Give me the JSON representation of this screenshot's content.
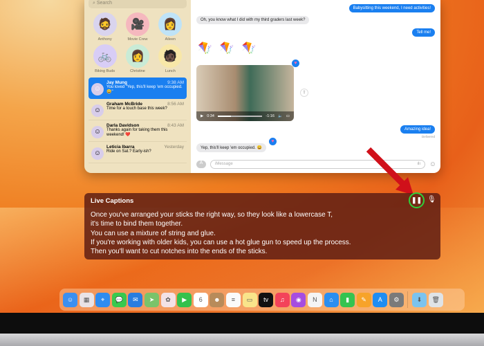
{
  "messages": {
    "search_placeholder": "Search",
    "pinned": [
      {
        "name": "Anthony",
        "emoji": "🧔",
        "color": "#d9d4ee"
      },
      {
        "name": "Movie Crew",
        "emoji": "🎥",
        "color": "#f5b8be"
      },
      {
        "name": "Aileen",
        "emoji": "👩",
        "color": "#bfe3f7"
      },
      {
        "name": "Biking Buds",
        "emoji": "🚲",
        "color": "#d8cdf6"
      },
      {
        "name": "Christine",
        "emoji": "👩",
        "color": "#c9ebd6"
      },
      {
        "name": "Lunch",
        "emoji": "🧑🏿",
        "color": "#f8e7a8"
      }
    ],
    "conversations": [
      {
        "name": "Jay Mung",
        "time": "9:38 AM",
        "preview": "You loved \"Yep, this'll keep 'em occupied. 😀\""
      },
      {
        "name": "Graham McBride",
        "time": "8:56 AM",
        "preview": "Time for a touch base this week?"
      },
      {
        "name": "Darla Davidson",
        "time": "8:43 AM",
        "preview": "Thanks again for taking them this weekend! ❤️"
      },
      {
        "name": "Leticia Ibarra",
        "time": "Yesterday",
        "preview": "Ride on Sat.? Early-ish?"
      }
    ],
    "chat": {
      "m1": "Babysitting this weekend, I need activities!",
      "m2": "Oh, you know what I did with my third graders last week?",
      "m3": "Tell me!",
      "kites": "🪁 🪁 🪁",
      "video_elapsed": "0:34",
      "video_remaining": "-1:16",
      "video_progress": 0.3,
      "m4": "Amazing idea!",
      "delivered": "Delivered",
      "m5": "Yep, this'll keep 'em occupied. 😀",
      "compose_placeholder": "iMessage"
    }
  },
  "live_captions": {
    "title": "Live Captions",
    "lines": [
      "Once you've arranged your sticks the right way, so they look like a lowercase T,",
      "it's time to bind them together.",
      "You can use a mixture of string and glue.",
      "If you're working with older kids, you can use a hot glue gun to speed up the process.",
      "Then you'll want to cut notches into the ends of the sticks."
    ]
  },
  "dock": [
    {
      "name": "Finder",
      "glyph": "☺",
      "color": "#3b8ff0"
    },
    {
      "name": "Launchpad",
      "glyph": "▦",
      "color": "#e9e3e6"
    },
    {
      "name": "Safari",
      "glyph": "⌖",
      "color": "#2f8cf0"
    },
    {
      "name": "Messages",
      "glyph": "💬",
      "color": "#38c94e"
    },
    {
      "name": "Mail",
      "glyph": "✉",
      "color": "#2a7de0"
    },
    {
      "name": "Maps",
      "glyph": "➤",
      "color": "#7ac36a"
    },
    {
      "name": "Photos",
      "glyph": "✿",
      "color": "#f3e2e6"
    },
    {
      "name": "FaceTime",
      "glyph": "▶",
      "color": "#33c14c"
    },
    {
      "name": "Calendar",
      "glyph": "6",
      "color": "#ffffff"
    },
    {
      "name": "Contacts",
      "glyph": "☻",
      "color": "#b88b5a"
    },
    {
      "name": "Reminders",
      "glyph": "≡",
      "color": "#fafafa"
    },
    {
      "name": "Notes",
      "glyph": "▭",
      "color": "#f9e48a"
    },
    {
      "name": "TV",
      "glyph": "tv",
      "color": "#111111"
    },
    {
      "name": "Music",
      "glyph": "♫",
      "color": "#f3435a"
    },
    {
      "name": "Podcasts",
      "glyph": "◉",
      "color": "#a64de0"
    },
    {
      "name": "News",
      "glyph": "N",
      "color": "#f4f4f4"
    },
    {
      "name": "Keynote",
      "glyph": "⌂",
      "color": "#2b8ef0"
    },
    {
      "name": "Numbers",
      "glyph": "▮",
      "color": "#35c350"
    },
    {
      "name": "Pages",
      "glyph": "✎",
      "color": "#f7a32a"
    },
    {
      "name": "App Store",
      "glyph": "A",
      "color": "#1f8df2"
    },
    {
      "name": "System Settings",
      "glyph": "⚙",
      "color": "#7a7a7a"
    }
  ],
  "dock_extra": [
    {
      "name": "Downloads",
      "glyph": "⬇",
      "color": "#7cc3ee"
    },
    {
      "name": "Trash",
      "glyph": "🗑",
      "color": "#dfe3e6"
    }
  ],
  "annotation_colors": {
    "arrow": "#d0101a",
    "highlight": "#2ed03a"
  }
}
